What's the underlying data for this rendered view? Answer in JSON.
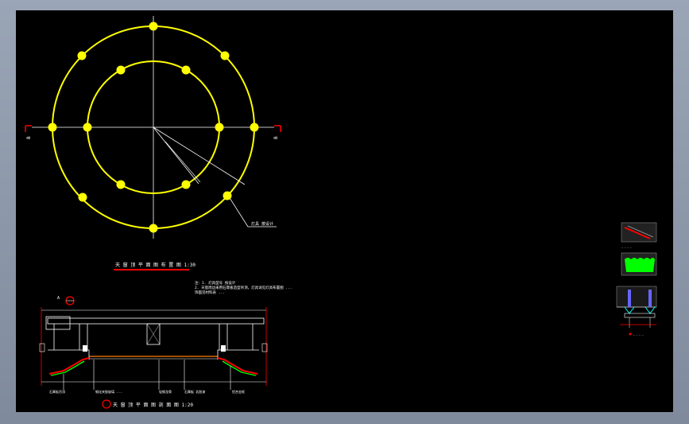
{
  "drawing": {
    "plan_title": "天 窗 顶 平 面 图 布 置 图   1:30",
    "section_title": "天 窗 顶 平 面 图 剖 面 图   1:20",
    "notes": [
      "注：1.  灯具型号   按设计",
      "    2.  天窗周边采用石膏板造型吊顶，灯具详见灯具布置图 ...",
      "        饰面见材料表 ..."
    ],
    "leader_label": "灯具   按设计",
    "section_mark_left": "B",
    "section_mark_right": "B",
    "detail_mark": "A",
    "section_labels": [
      "石膏板吊顶",
      "钢化夹胶玻璃 ...",
      "轻钢龙骨",
      "石膏板 乳胶漆",
      "铝合金框"
    ],
    "colors": {
      "background": "#000000",
      "circle": "#ffff00",
      "lines": "#ffffff",
      "accent": "#ff0000",
      "fill_green": "#00ff00"
    }
  }
}
